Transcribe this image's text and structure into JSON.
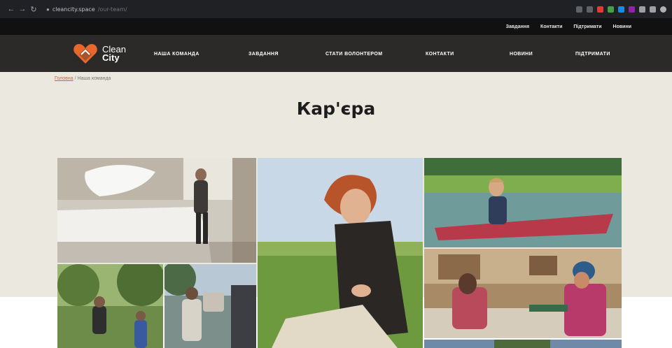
{
  "browser": {
    "url_domain": "cleancity.space",
    "url_path": "/our-team/",
    "nav_icons": [
      "back-arrow-icon",
      "forward-arrow-icon",
      "reload-icon"
    ]
  },
  "topbar": {
    "links": [
      "Завдання",
      "Контакти",
      "Підтримати",
      "Новини"
    ]
  },
  "logo": {
    "line1": "Clean",
    "line2": "City",
    "brand_color": "#e8672d"
  },
  "mainnav": {
    "links": [
      "НАША КОМАНДА",
      "ЗАВДАННЯ",
      "СТАТИ ВОЛОНТЕРОМ",
      "КОНТАКТИ",
      "НОВИНИ",
      "ПІДТРИМАТИ"
    ]
  },
  "breadcrumb": {
    "home": "Головна",
    "separator": "/",
    "current": "Наша команда"
  },
  "page": {
    "title": "Кар'єра"
  },
  "colors": {
    "accent": "#d4622f",
    "hero_bg": "#ebe8df",
    "nav_bg": "#2b2a29",
    "topbar_bg": "#111111"
  }
}
